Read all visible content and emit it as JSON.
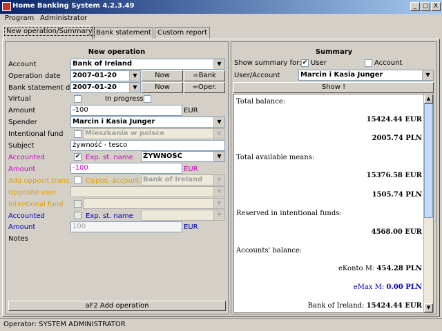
{
  "window": {
    "title": "Home Banking System 4.2.3.49",
    "minimize": "_",
    "maximize": "□",
    "close": "X"
  },
  "menu": [
    {
      "label": "Program"
    },
    {
      "label": "Administrator"
    }
  ],
  "tabs": [
    {
      "label": "New operation/Summary",
      "active": true
    },
    {
      "label": "Bank statement",
      "active": false
    },
    {
      "label": "Custom report",
      "active": false
    }
  ],
  "new_operation": {
    "title": "New operation",
    "account": {
      "label": "Account",
      "value": "Bank of Ireland"
    },
    "operation_date": {
      "label": "Operation date",
      "value": "2007-01-20",
      "btn1": "Now",
      "btn2": "=Bank"
    },
    "statement_date": {
      "label": "Bank statement date",
      "value": "2007-01-20",
      "btn1": "Now",
      "btn2": "=Oper."
    },
    "virtual": {
      "label": "Virtual",
      "checked": false
    },
    "in_progress": {
      "label": "In progress",
      "checked": false
    },
    "amount": {
      "label": "Amount",
      "value": "-100",
      "currency": "EUR"
    },
    "spender": {
      "label": "Spender",
      "value": "Marcin i Kasia Junger"
    },
    "intentional_fund": {
      "label": "Intentional fund",
      "value": "Mieszkanie w polsce"
    },
    "subject": {
      "label": "Subject",
      "value": "żywność - tesco"
    },
    "accounted": {
      "label": "Accounted",
      "checked": true,
      "exp_label": "Exp. st. name",
      "exp_value": "ŻYWNOŚĆ"
    },
    "amount2": {
      "label": "Amount",
      "value": "-100",
      "currency": "EUR"
    },
    "add_opposit": {
      "label": "Add opposit trans.",
      "opp_account_label": "Oppos. account",
      "opp_account_value": "Bank of Ireland"
    },
    "opposite_user": {
      "label": "Opposite user"
    },
    "intentional_fund2": {
      "label": "Intentional fund"
    },
    "accounted2": {
      "label": "Accounted",
      "exp_label": "Exp. st. name"
    },
    "amount3": {
      "label": "Amount",
      "value": "100",
      "currency": "EUR"
    },
    "notes": {
      "label": "Notes"
    },
    "add_button": "aF2 Add operation"
  },
  "summary": {
    "title": "Summary",
    "show_for_label": "Show summary for:",
    "user_checkbox": {
      "label": "User",
      "checked": true
    },
    "account_checkbox": {
      "label": "Account",
      "checked": false
    },
    "user_account_label": "User/Account",
    "user_account_value": "Marcin i Kasia Junger",
    "show_button": "Show !",
    "total_balance_label": "Total balance:",
    "total_balance_eur": "15424.44 EUR",
    "total_balance_pln": "2005.74 PLN",
    "available_label": "Total available means:",
    "available_eur": "15376.58 EUR",
    "available_pln": "1505.74 PLN",
    "reserved_label": "Reserved in intentional funds:",
    "reserved_value": "4568.00 EUR",
    "accounts_label": "Accounts' balance:",
    "accounts": [
      {
        "name": "eKonto M:",
        "value": "454.28 PLN",
        "color": "#000000"
      },
      {
        "name": "eMax M:",
        "value": "0.00 PLN",
        "color": "#0000c0"
      },
      {
        "name": "Bank of Ireland:",
        "value": "15424.44 EUR",
        "color": "#000000"
      }
    ]
  },
  "status": {
    "operator": "Operator: SYSTEM ADMINISTRATOR"
  }
}
